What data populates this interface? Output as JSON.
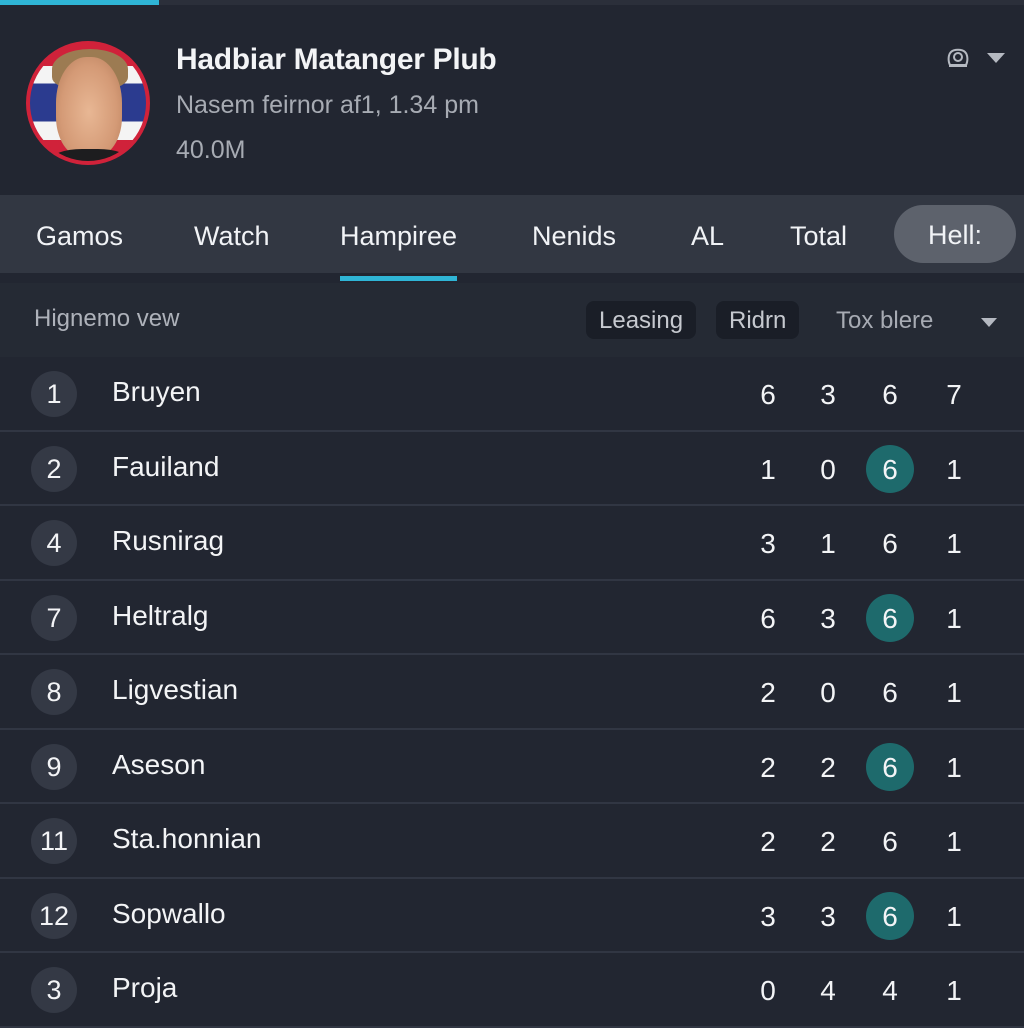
{
  "progress": {
    "percent": 15.5,
    "color": "#2fb5d6"
  },
  "header": {
    "title": "Hadbiar Matanger Plub",
    "subtitle": "Nasem feirnor af1, 1.34 pm",
    "meta": "40.0M",
    "avatar_icon": "profile-photo",
    "actions": [
      {
        "icon": "webcam-icon"
      },
      {
        "icon": "caret-down-icon"
      }
    ]
  },
  "tabs": [
    {
      "label": "Gamos",
      "active": false
    },
    {
      "label": "Watch",
      "active": false
    },
    {
      "label": "Hampiree",
      "active": true
    },
    {
      "label": "Nenids",
      "active": false
    },
    {
      "label": "AL",
      "active": false
    },
    {
      "label": "Total",
      "active": false
    },
    {
      "label": "Hell:",
      "active": false,
      "pill": true
    }
  ],
  "subbar": {
    "view_label": "Hignemo vew",
    "chips": [
      "Leasing",
      "Ridrn"
    ],
    "sort_label": "Tox blere",
    "sort_icon": "caret-down-icon"
  },
  "rows": [
    {
      "rank": "1",
      "name": "Bruyen",
      "stats": [
        "6",
        "3",
        "6",
        "7"
      ],
      "highlight": false
    },
    {
      "rank": "2",
      "name": "Fauiland",
      "stats": [
        "1",
        "0",
        "6",
        "1"
      ],
      "highlight": true
    },
    {
      "rank": "4",
      "name": "Rusnirag",
      "stats": [
        "3",
        "1",
        "6",
        "1"
      ],
      "highlight": false
    },
    {
      "rank": "7",
      "name": "Heltralg",
      "stats": [
        "6",
        "3",
        "6",
        "1"
      ],
      "highlight": true
    },
    {
      "rank": "8",
      "name": "Ligvestian",
      "stats": [
        "2",
        "0",
        "6",
        "1"
      ],
      "highlight": false
    },
    {
      "rank": "9",
      "name": "Aseson",
      "stats": [
        "2",
        "2",
        "6",
        "1"
      ],
      "highlight": true
    },
    {
      "rank": "11",
      "name": "Sta.honnian",
      "stats": [
        "2",
        "2",
        "6",
        "1"
      ],
      "highlight": false
    },
    {
      "rank": "12",
      "name": "Sopwallo",
      "stats": [
        "3",
        "3",
        "6",
        "1"
      ],
      "highlight": true
    },
    {
      "rank": "3",
      "name": "Proja",
      "stats": [
        "0",
        "4",
        "4",
        "1"
      ],
      "highlight": false
    }
  ],
  "colors": {
    "background": "#222631",
    "tabbar": "#323742",
    "accent": "#2fb5d6",
    "highlight": "#1e6a6c"
  }
}
